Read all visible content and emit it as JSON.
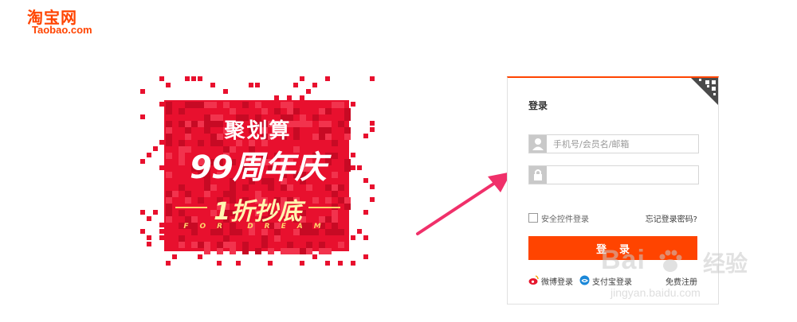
{
  "brand": {
    "name_cn": "淘宝网",
    "name_en": "Taobao.com",
    "color": "#ff4400"
  },
  "promo": {
    "line1": "聚划算",
    "line2": "99周年庆",
    "line3": "1折抄底",
    "line4": "FOR DREAM",
    "bg_color": "#e8102e"
  },
  "login": {
    "title": "登录",
    "qr_icon": "qr-code-icon",
    "username": {
      "placeholder": "手机号/会员名/邮箱",
      "value": "",
      "icon": "user-icon"
    },
    "password": {
      "placeholder": "",
      "value": "",
      "icon": "lock-icon"
    },
    "secure_control_label": "安全控件登录",
    "secure_control_checked": false,
    "forgot_label": "忘记登录密码?",
    "submit_label": "登录",
    "alt_logins": [
      {
        "label": "微博登录",
        "icon": "weibo-icon"
      },
      {
        "label": "支付宝登录",
        "icon": "alipay-icon"
      }
    ],
    "register_label": "免费注册"
  },
  "annotation": {
    "arrow_color": "#f0306a",
    "arrow_icon": "pointer-arrow-icon"
  },
  "watermark": {
    "logo": "Bai",
    "logo_suffix": "经验",
    "url": "jingyan.baidu.com"
  }
}
